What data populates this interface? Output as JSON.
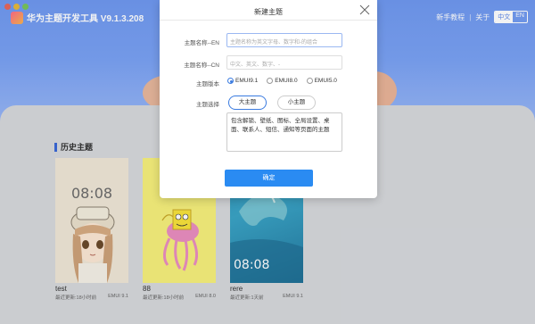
{
  "app": {
    "title": "华为主题开发工具 V9.1.3.208",
    "top_right": {
      "tutorial": "新手教程",
      "separator": "|",
      "about": "关于",
      "lang_cn": "中文",
      "lang_en": "EN"
    }
  },
  "history": {
    "title": "历史主题",
    "cards": [
      {
        "name": "test",
        "updated": "最近更新:18小时前",
        "version": "EMUI 9.1",
        "time": "08:08"
      },
      {
        "name": "88",
        "updated": "最近更新:18小时前",
        "version": "EMUI 8.0"
      },
      {
        "name": "rere",
        "updated": "最近更新:1天前",
        "version": "EMUI 9.1",
        "time": "08:08"
      }
    ]
  },
  "modal": {
    "title": "新建主题",
    "name_en_label": "主题名称--EN",
    "name_en_placeholder": "主题名称为英文字母、数字和-的组合",
    "name_cn_label": "主题名称--CN",
    "name_cn_placeholder": "中文、英文、数字、-",
    "version_label": "主题版本",
    "versions": [
      "EMUI9.1",
      "EMUI8.0",
      "EMUI5.0"
    ],
    "selected_version": "EMUI9.1",
    "theme_select_label": "主题选择",
    "theme_big": "大主题",
    "theme_small": "小主题",
    "description": "包含解锁、壁纸、图标、全局设置、桌面、联系人、短信、通知等页面的主题",
    "confirm": "确定"
  },
  "colors": {
    "header_blue": "#7aa2f4",
    "primary_button": "#2a8bf2",
    "radio_selected": "#3a7be0"
  }
}
